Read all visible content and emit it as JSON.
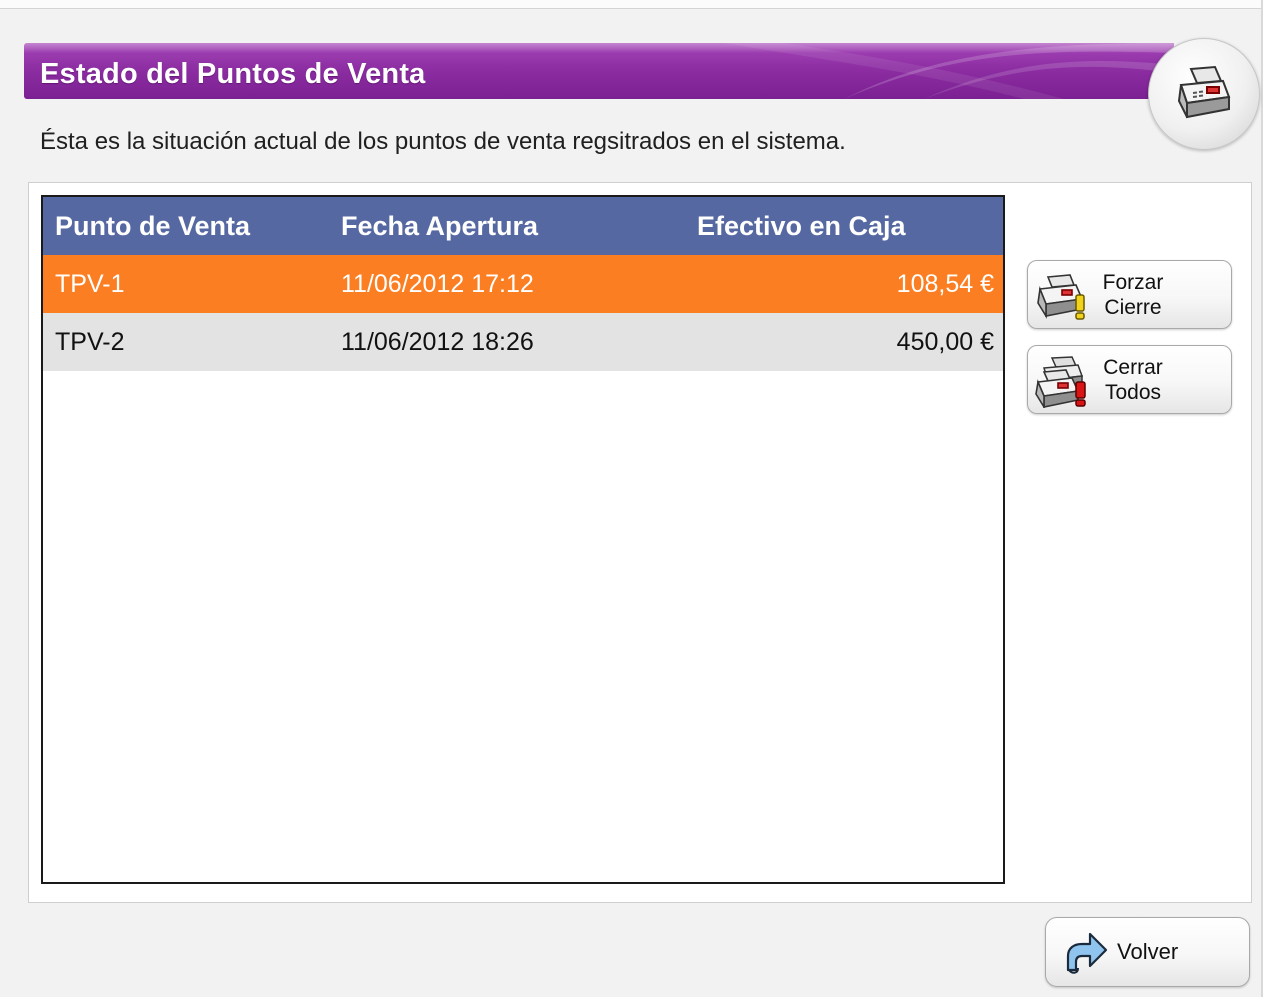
{
  "header": {
    "title": "Estado del Puntos de Venta",
    "icon": "cash-register-icon",
    "band_color": "#8d2ea3"
  },
  "description": "Ésta es la situación actual de los puntos de venta regsitrados en el sistema.",
  "table": {
    "columns": [
      "Punto de Venta",
      "Fecha Apertura",
      "Efectivo en Caja"
    ],
    "header_color": "#5668a1",
    "rows": [
      {
        "punto": "TPV-1",
        "fecha": "11/06/2012 17:12",
        "efectivo": "108,54 €",
        "selected": true,
        "color": "#fb7f22"
      },
      {
        "punto": "TPV-2",
        "fecha": "11/06/2012 18:26",
        "efectivo": "450,00 €",
        "selected": false,
        "color": "#e3e3e3"
      }
    ]
  },
  "actions": {
    "forzar": {
      "line1": "Forzar",
      "line2": "Cierre",
      "icon": "cash-register-warning-icon"
    },
    "cerrar": {
      "line1": "Cerrar",
      "line2": "Todos",
      "icon": "cash-registers-alert-icon"
    }
  },
  "footer": {
    "volver_label": "Volver",
    "volver_icon": "return-arrow-icon"
  }
}
